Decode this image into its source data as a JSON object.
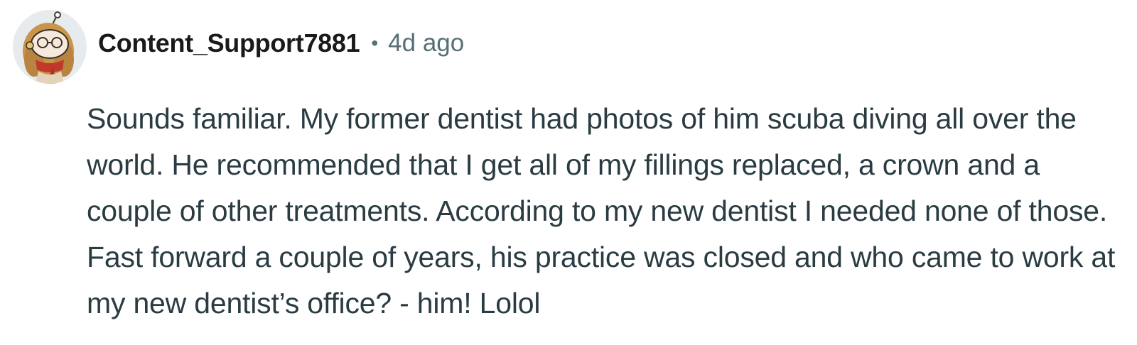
{
  "comment": {
    "author": "Content_Support7881",
    "separator": "•",
    "time": "4d ago",
    "body": "Sounds familiar. My former dentist had photos of him scuba diving all over the world. He recommended that I get all of my fillings replaced, a crown and a couple of other treatments. According to my new dentist I needed none of those. Fast forward a couple of years, his practice was closed and who came to work at my new dentist’s office? - him! Lolol"
  },
  "avatar": {
    "icon": "reddit-snoo-avatar-icon"
  },
  "colors": {
    "username": "#1a1a1b",
    "meta": "#576f76",
    "body": "#2a3c42",
    "avatar_bg": "#e9ecef"
  }
}
